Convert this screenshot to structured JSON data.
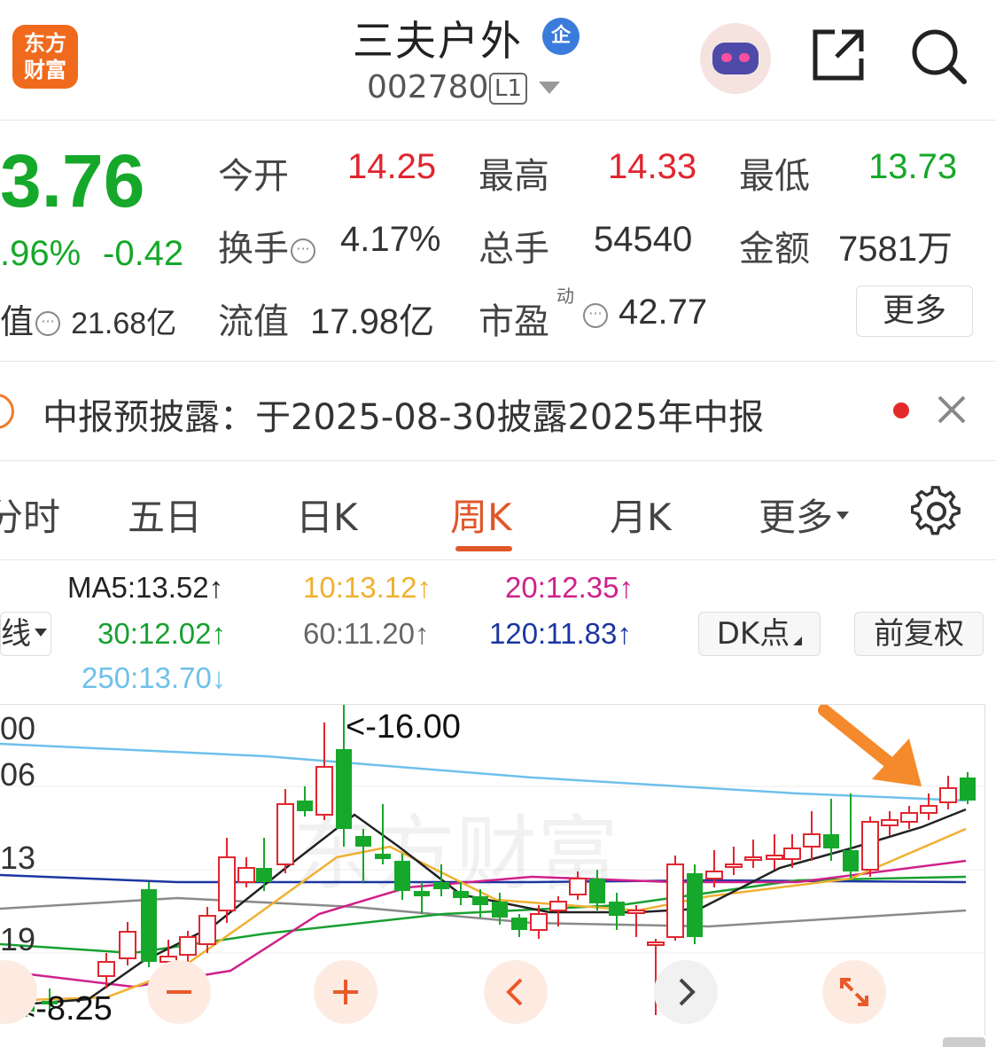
{
  "header": {
    "logo_text": "东方财富",
    "stock_name": "三夫户外",
    "enterprise_badge": "企",
    "stock_code": "002780",
    "level_badge": "L1"
  },
  "quote": {
    "price": "3.76",
    "change_pct": ".96%",
    "change": "-0.42",
    "market_cap_label": "值",
    "market_cap_value": "21.68亿",
    "open_label": "今开",
    "open_value": "14.25",
    "high_label": "最高",
    "high_value": "14.33",
    "low_label": "最低",
    "low_value": "13.73",
    "turnover_label": "换手",
    "turnover_value": "4.17%",
    "volume_label": "总手",
    "volume_value": "54540",
    "amount_label": "金额",
    "amount_value": "7581万",
    "float_cap_label": "流值",
    "float_cap_value": "17.98亿",
    "pe_label": "市盈",
    "pe_superscript": "动",
    "pe_value": "42.77",
    "more_label": "更多"
  },
  "notice": {
    "text": "中报预披露：于2025-08-30披露2025年中报"
  },
  "tabs": [
    {
      "label": "分时"
    },
    {
      "label": "五日"
    },
    {
      "label": "日K"
    },
    {
      "label": "周K"
    },
    {
      "label": "月K"
    },
    {
      "label": "更多"
    }
  ],
  "ma_legend": {
    "ma5": "MA5:13.52↑",
    "ma10": "10:13.12↑",
    "ma20": "20:12.35↑",
    "ma30": "30:12.02↑",
    "ma60": "60:11.20↑",
    "ma120": "120:11.83↑",
    "ma250": "250:13.70↓",
    "line_type": "线",
    "dk_label": "DK点",
    "adjust_label": "前复权"
  },
  "colors": {
    "up": "#e0262f",
    "down": "#16a82a",
    "accent": "#e0572a",
    "ma5": "#222222",
    "ma10": "#f0b030",
    "ma20": "#d0208a",
    "ma30": "#18a030",
    "ma60": "#8a8a8a",
    "ma120": "#1c36a0",
    "ma250": "#6ec1ea"
  },
  "chart": {
    "y_labels": [
      "00",
      "06",
      "13",
      "19"
    ],
    "high_annotation": "<-16.00",
    "low_annotation": "<-8.25",
    "watermark": "东方财富"
  },
  "chart_data": {
    "type": "candlestick",
    "period": "weekly",
    "max_price": 16.0,
    "min_price": 8.25,
    "last_close": 13.76
  }
}
